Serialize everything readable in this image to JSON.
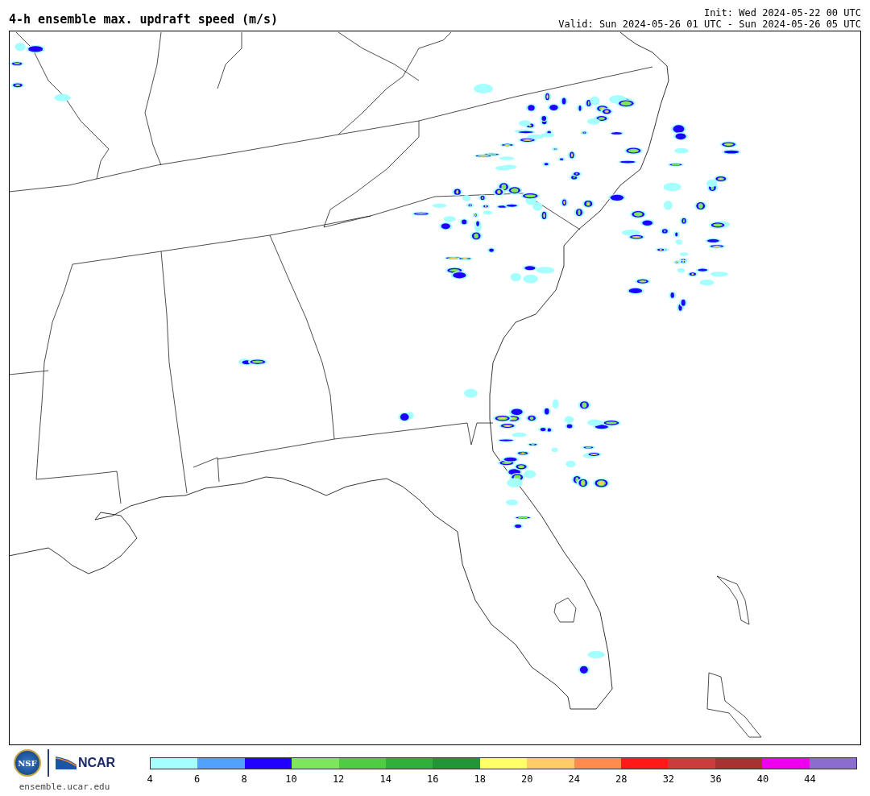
{
  "title": "4-h ensemble max. updraft speed (m/s)",
  "init": "Init: Wed 2024-05-22 00 UTC",
  "valid": "Valid: Sun 2024-05-26 01 UTC - Sun 2024-05-26 05 UTC",
  "logos": {
    "nsf": "NSF",
    "ncar": "NCAR",
    "url": "ensemble.ucar.edu"
  },
  "colorbar": {
    "segments": [
      {
        "color": "#a6ffff"
      },
      {
        "color": "#52a0ff"
      },
      {
        "color": "#2000ff"
      },
      {
        "color": "#7ee65a"
      },
      {
        "color": "#4ecd44"
      },
      {
        "color": "#2eb03c"
      },
      {
        "color": "#209638"
      },
      {
        "color": "#ffff66"
      },
      {
        "color": "#ffcc66"
      },
      {
        "color": "#ff8c4c"
      },
      {
        "color": "#ff1a1a"
      },
      {
        "color": "#cc3c3c"
      },
      {
        "color": "#a63232"
      },
      {
        "color": "#ee00ee"
      },
      {
        "color": "#8c6ccc"
      }
    ],
    "ticks": [
      "4",
      "6",
      "8",
      "10",
      "12",
      "14",
      "16",
      "18",
      "20",
      "24",
      "28",
      "32",
      "36",
      "40",
      "44"
    ]
  }
}
